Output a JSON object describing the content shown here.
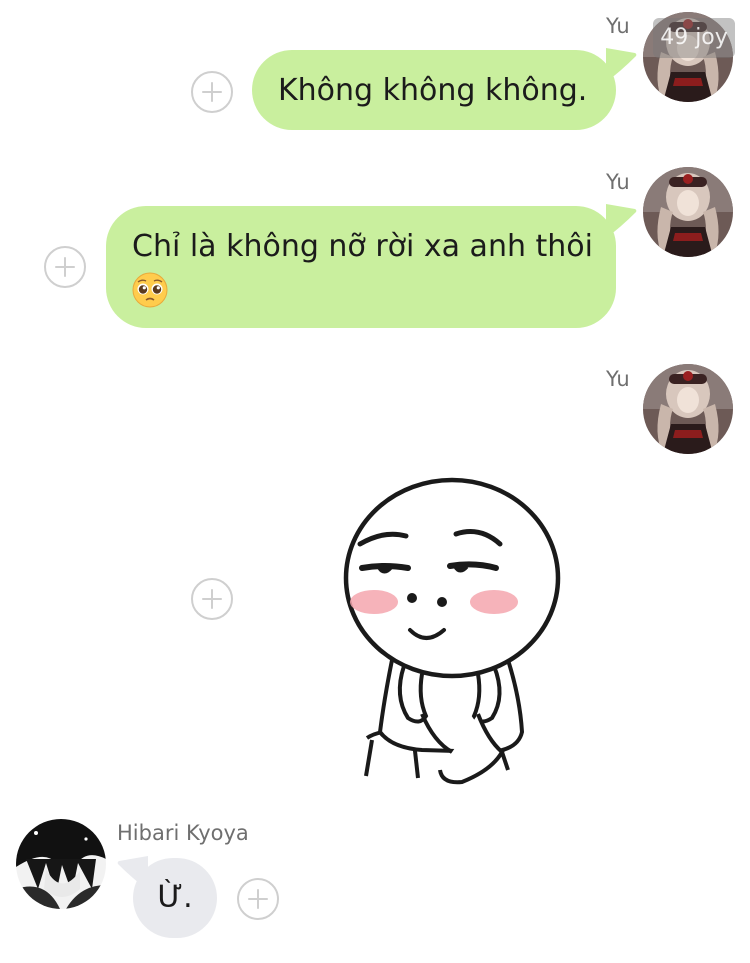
{
  "watermark": "49 joy",
  "messages": [
    {
      "sender": "Yu",
      "direction": "outgoing",
      "type": "text",
      "text": "Không không không."
    },
    {
      "sender": "Yu",
      "direction": "outgoing",
      "type": "text",
      "text": "Chỉ là không nỡ rời xa anh thôi",
      "emoji": "pleading-face-emoji"
    },
    {
      "sender": "Yu",
      "direction": "outgoing",
      "type": "sticker",
      "sticker": "shy-round-face-character-sticker"
    },
    {
      "sender": "Hibari Kyoya",
      "direction": "incoming",
      "type": "text",
      "text": "Ừ."
    }
  ],
  "colors": {
    "outgoing_bubble": "#c9ef9e",
    "incoming_bubble": "#e9eaee",
    "add_button": "#cfcfcf",
    "sender_name": "#6f6f6f",
    "sticker_blush": "#f4a6ae"
  }
}
